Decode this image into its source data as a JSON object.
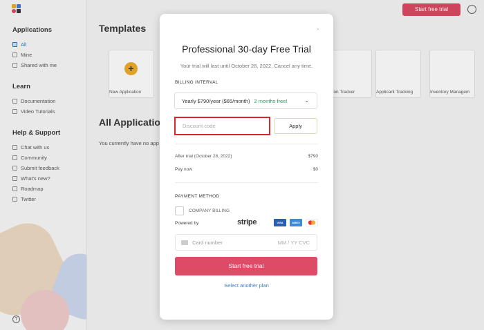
{
  "app": {
    "top_button": "Start free trial",
    "sidebar": {
      "sections": [
        {
          "title": "Applications",
          "items": [
            "All",
            "Mine",
            "Shared with me"
          ]
        },
        {
          "title": "Learn",
          "items": [
            "Documentation",
            "Video Tutorials"
          ]
        },
        {
          "title": "Help & Support",
          "items": [
            "Chat with us",
            "Community",
            "Submit feedback",
            "What's new?",
            "Roadmap",
            "Twitter"
          ]
        }
      ],
      "help_icon": "?"
    },
    "main": {
      "templates_title": "Templates",
      "templates": [
        "New Application",
        "ion Tracker",
        "Applicant Tracking",
        "Inventory Managem"
      ],
      "all_apps_title": "All Applicatio",
      "empty_text": "You currently have no app"
    }
  },
  "modal": {
    "close": "×",
    "title": "Professional 30-day Free Trial",
    "subtitle": "Your trial will last until October 28, 2022. Cancel any time.",
    "billing_label": "BILLING INTERVAL",
    "billing_value": "Yearly $790/year ($65/month)",
    "billing_badge": "2 months free!",
    "discount_placeholder": "Discount code",
    "apply_label": "Apply",
    "after_trial_label": "After trial (October 28, 2022)",
    "after_trial_value": "$790",
    "pay_now_label": "Pay now",
    "pay_now_value": "$0",
    "payment_label": "PAYMENT METHOD",
    "company_billing": "COMPANY BILLING",
    "powered_by": "Powered by",
    "stripe": "stripe",
    "card_brands": [
      "VISA",
      "AMEX",
      "MC"
    ],
    "card_placeholder": "Card number",
    "card_exp_cvc": "MM / YY  CVC",
    "start_button": "Start free trial",
    "other_plan": "Select another plan"
  },
  "colors": {
    "accent": "#dd4b67",
    "link": "#3f78c9",
    "discount_border": "#d8262e",
    "badge_green": "#2c9c5a"
  }
}
